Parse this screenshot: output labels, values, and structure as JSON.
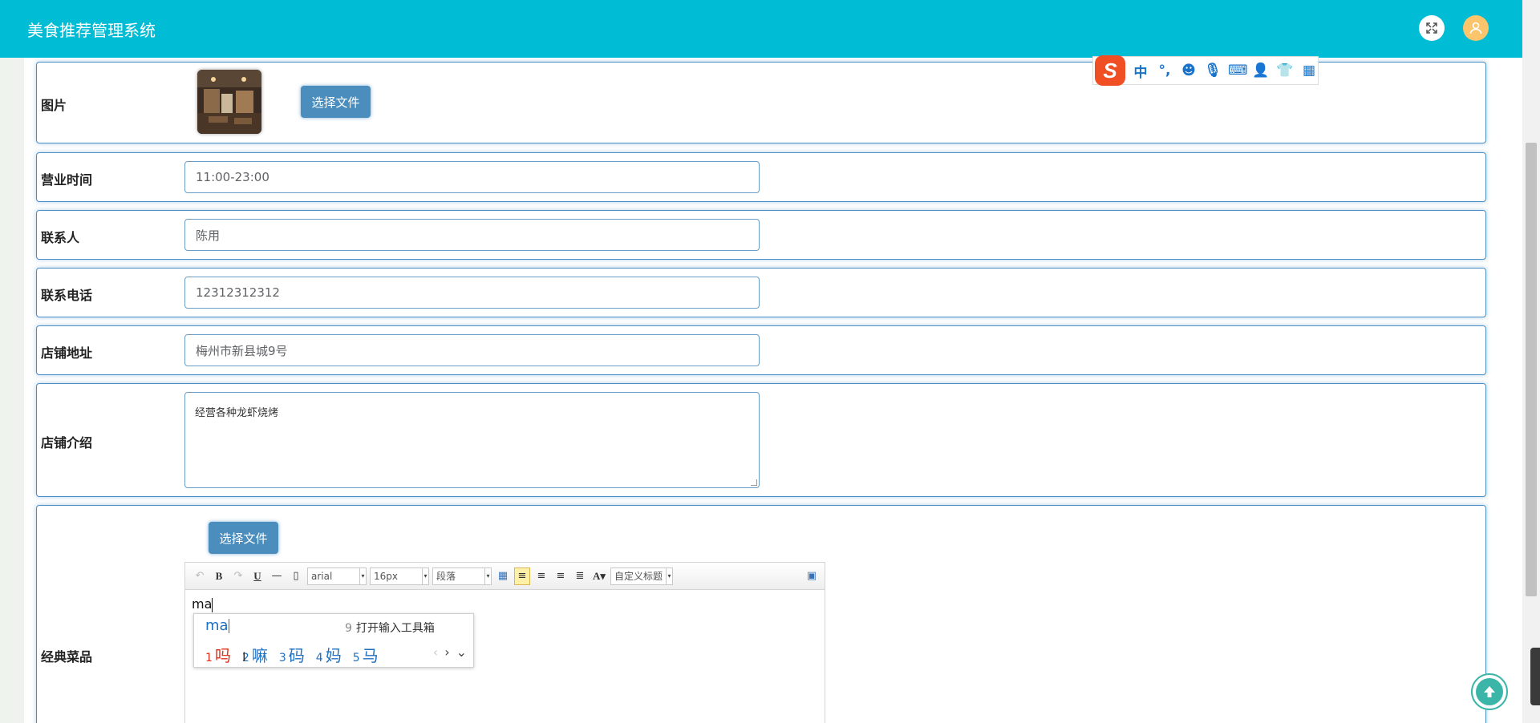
{
  "app": {
    "title": "美食推荐管理系统"
  },
  "header": {
    "fullscreen_icon": "expand-icon",
    "avatar_icon": "user-icon",
    "accent": "#00bcd4"
  },
  "form": {
    "image": {
      "label": "图片",
      "button": "选择文件"
    },
    "hours": {
      "label": "营业时间",
      "value": "11:00-23:00"
    },
    "contact": {
      "label": "联系人",
      "value": "陈用"
    },
    "phone": {
      "label": "联系电话",
      "value": "12312312312"
    },
    "address": {
      "label": "店铺地址",
      "value": "梅州市新县城9号"
    },
    "intro": {
      "label": "店铺介绍",
      "value": "经营各种龙虾烧烤"
    },
    "dishes": {
      "label": "经典菜品",
      "button": "选择文件",
      "editor": {
        "font": "arial",
        "size": "16px",
        "paragraph": "段落",
        "custom_title": "自定义标题",
        "content": "ma"
      }
    }
  },
  "ime": {
    "composition": "ma",
    "toolbox": {
      "num": "9",
      "label": "打开输入工具箱"
    },
    "candidates": [
      {
        "num": "1",
        "text": "吗"
      },
      {
        "num": "2",
        "text": "嘛"
      },
      {
        "num": "3",
        "text": "码"
      },
      {
        "num": "4",
        "text": "妈"
      },
      {
        "num": "5",
        "text": "马"
      }
    ],
    "bar": {
      "logo": "S",
      "mode": "中",
      "punct": "°,"
    }
  }
}
